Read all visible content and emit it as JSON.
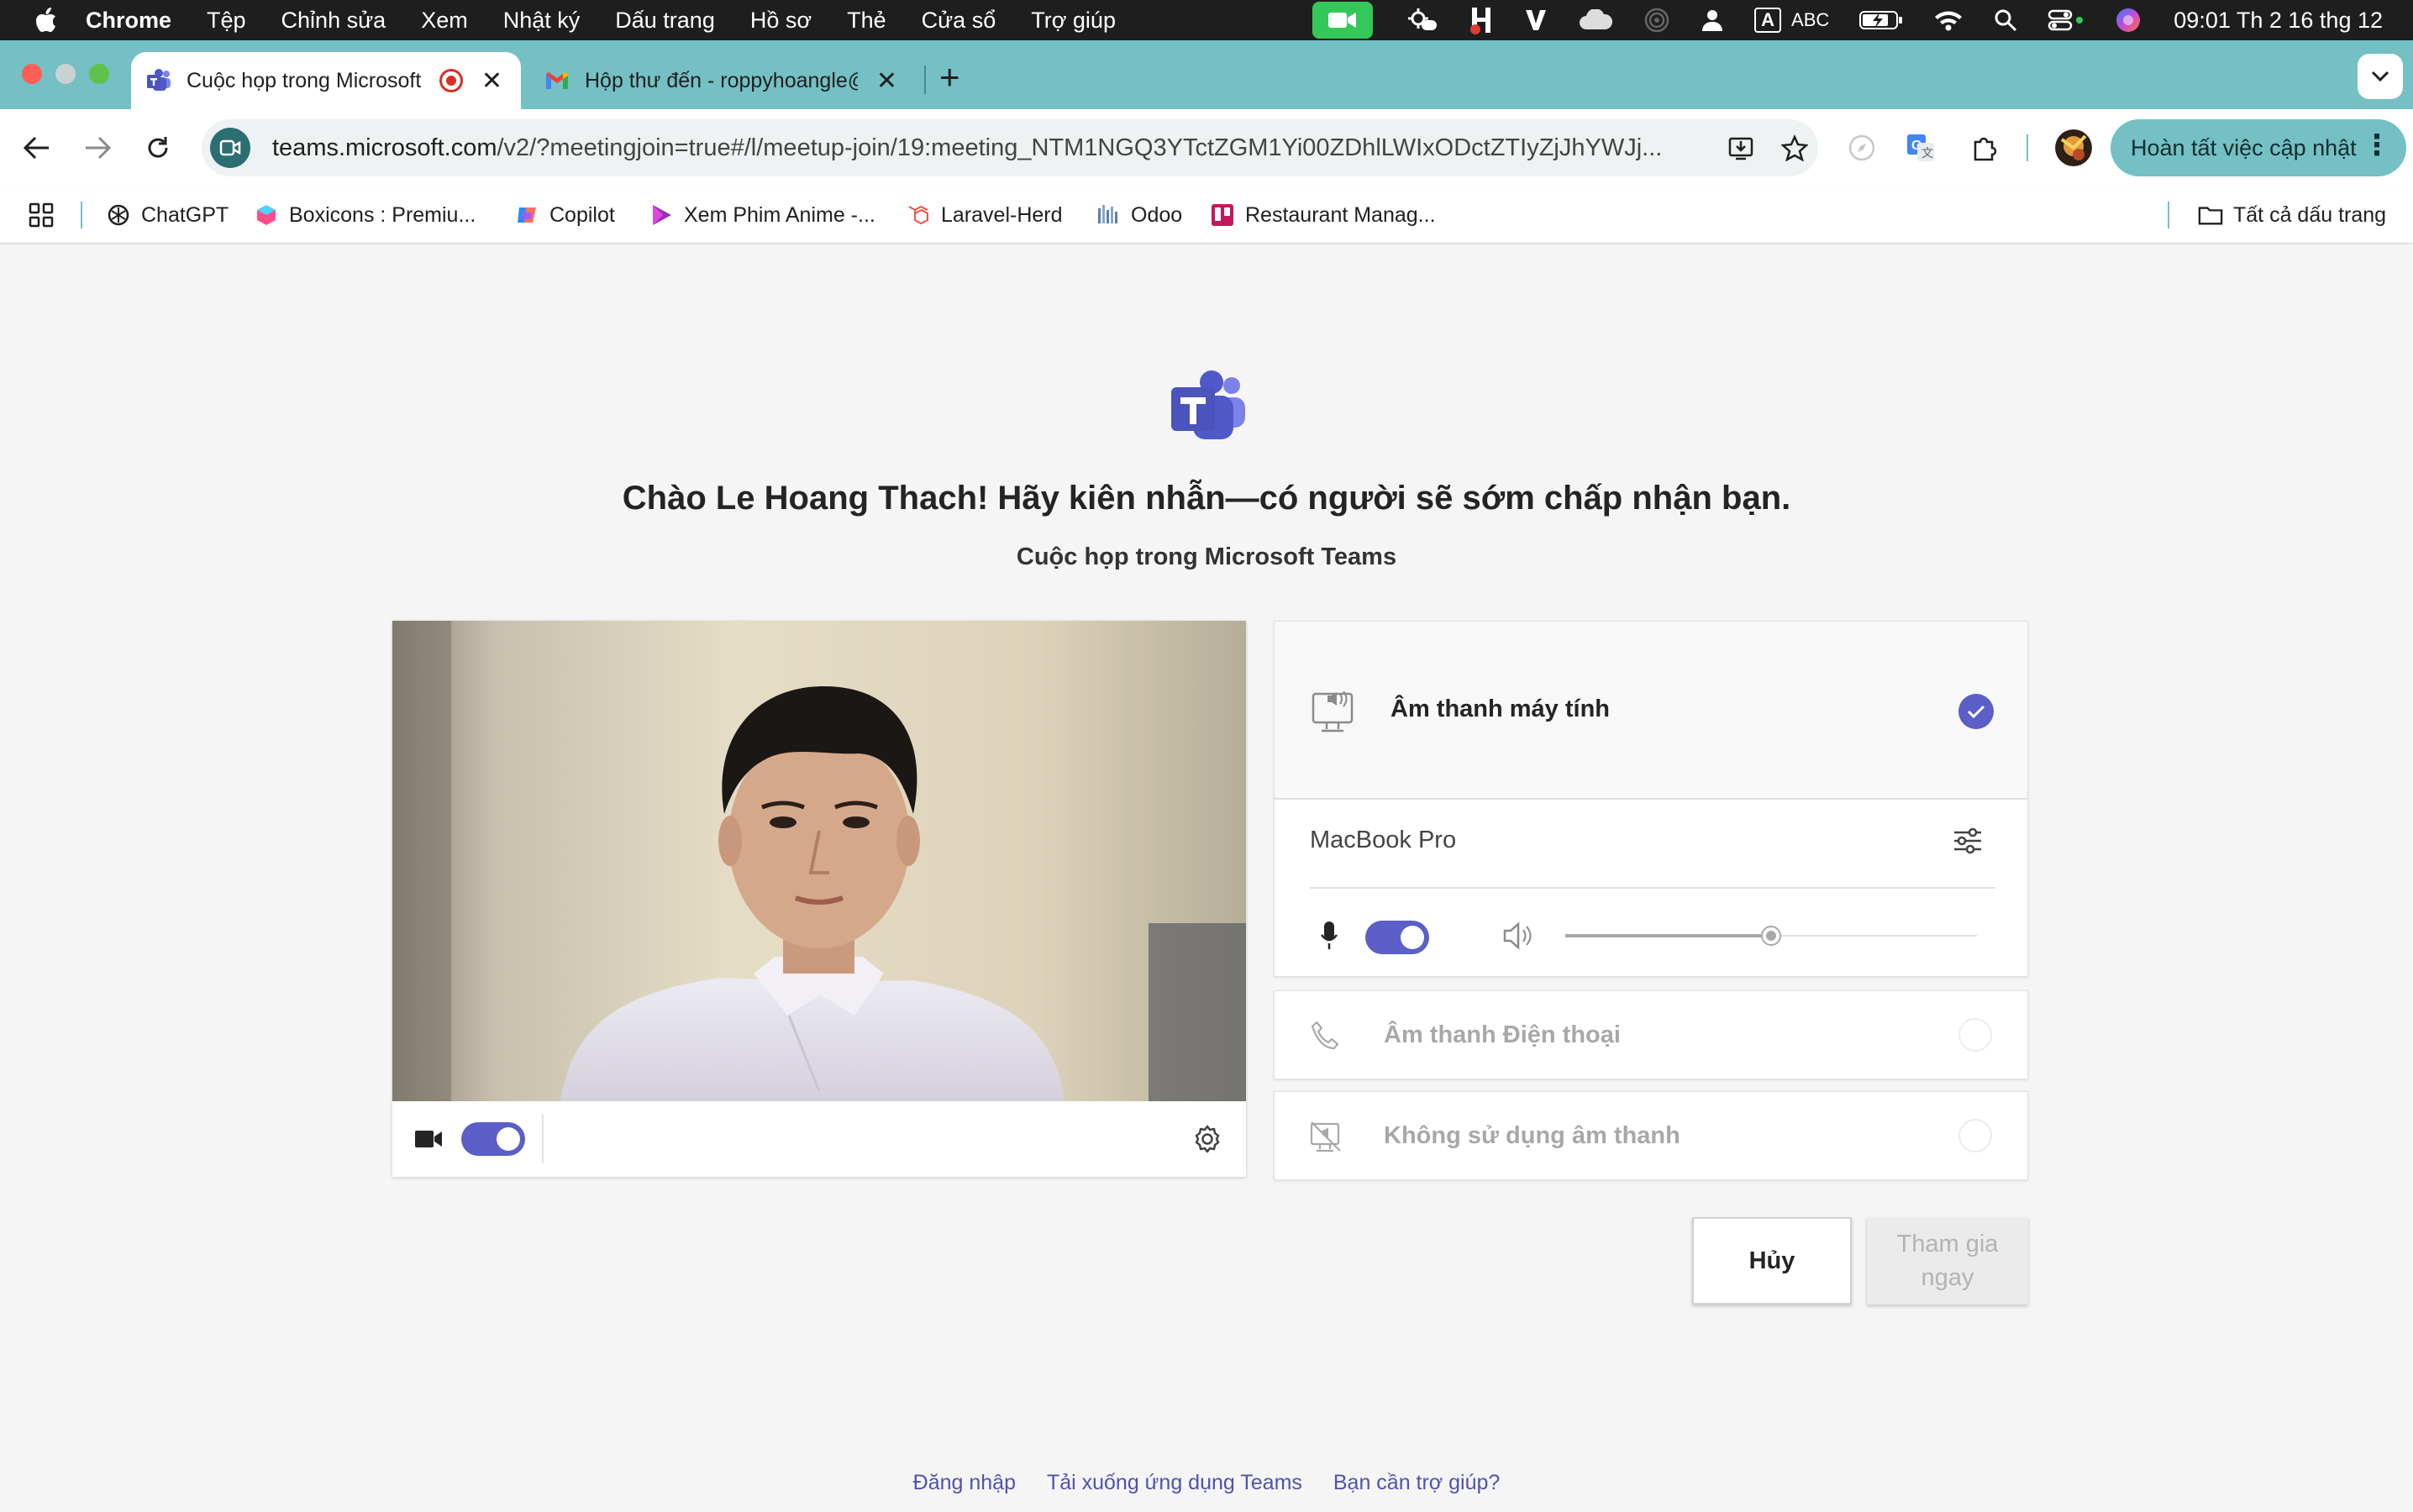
{
  "menubar": {
    "app_name": "Chrome",
    "items": [
      "Tệp",
      "Chỉnh sửa",
      "Xem",
      "Nhật ký",
      "Dấu trang",
      "Hồ sơ",
      "Thẻ",
      "Cửa sổ",
      "Trợ giúp"
    ],
    "input_source": "ABC",
    "clock": "09:01 Th 2 16 thg 12"
  },
  "tabs": [
    {
      "title": "Cuộc họp trong Microsoft Teams",
      "icon": "teams-icon",
      "recording": true,
      "active": true
    },
    {
      "title": "Hộp thư đến - roppyhoangle@gmail.com",
      "icon": "gmail-icon",
      "active": false
    }
  ],
  "address_bar": {
    "url_host": "teams.microsoft.com",
    "url_rest": "/v2/?meetingjoin=true#/l/meetup-join/19:meeting_NTM1NGQ3YTctZGM1Yi00ZDhlLWIxODctZTIyZjJhYWJj...",
    "update_button": "Hoàn tất việc cập nhật"
  },
  "bookmarks": {
    "items": [
      {
        "label": "ChatGPT",
        "icon": "openai-icon"
      },
      {
        "label": "Boxicons : Premiu...",
        "icon": "boxicons-icon"
      },
      {
        "label": "Copilot",
        "icon": "copilot-icon"
      },
      {
        "label": "Xem Phim Anime -...",
        "icon": "play-icon"
      },
      {
        "label": "Laravel-Herd",
        "icon": "laravel-icon"
      },
      {
        "label": "Odoo",
        "icon": "odoo-icon"
      },
      {
        "label": "Restaurant Manag...",
        "icon": "trello-icon"
      }
    ],
    "all_bookmarks": "Tất cả dấu trang"
  },
  "lobby": {
    "greeting": "Chào Le Hoang Thach! Hãy kiên nhẫn—có người sẽ sớm chấp nhận bạn.",
    "subtitle": "Cuộc họp trong Microsoft Teams",
    "camera_on": true
  },
  "audio": {
    "computer_audio_label": "Âm thanh máy tính",
    "computer_audio_selected": true,
    "device_name": "MacBook Pro",
    "mic_on": true,
    "speaker_volume": 0.5,
    "phone_audio_label": "Âm thanh Điện thoại",
    "no_audio_label": "Không sử dụng âm thanh"
  },
  "actions": {
    "cancel": "Hủy",
    "join_now": "Tham gia ngay",
    "join_enabled": false
  },
  "footer": {
    "sign_in": "Đăng nhập",
    "download": "Tải xuống ứng dụng Teams",
    "help": "Bạn cần trợ giúp?"
  },
  "colors": {
    "accent": "#5b5fc7",
    "chrome_theme": "#74c0c4",
    "record_red": "#d93025"
  }
}
